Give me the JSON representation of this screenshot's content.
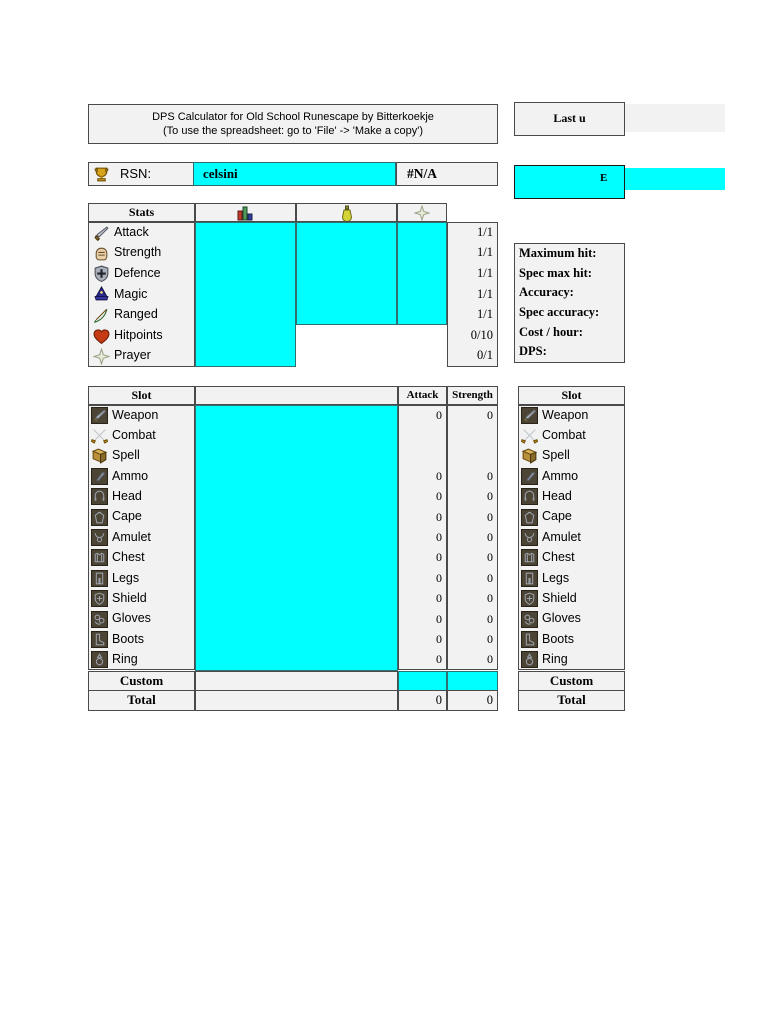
{
  "title": {
    "line1": "DPS Calculator for Old School Runescape by Bitterkoekje",
    "line2": "(To use the spreadsheet: go to 'File' -> 'Make a copy')"
  },
  "rsn": {
    "icon": "trophy-icon",
    "label": "RSN:",
    "value": "celsini",
    "status": "#N/A"
  },
  "stats": {
    "header": {
      "name": "Stats",
      "col_level_icon": "potions-icon",
      "col_boost_icon": "potion-flask-icon",
      "col_prayer_icon": "prayer-star-icon"
    },
    "rows": [
      {
        "icon": "attack-icon",
        "label": "Attack",
        "ratio": "1/1"
      },
      {
        "icon": "strength-icon",
        "label": "Strength",
        "ratio": "1/1"
      },
      {
        "icon": "defence-icon",
        "label": "Defence",
        "ratio": "1/1"
      },
      {
        "icon": "magic-icon",
        "label": "Magic",
        "ratio": "1/1"
      },
      {
        "icon": "ranged-icon",
        "label": "Ranged",
        "ratio": "1/1"
      },
      {
        "icon": "hitpoints-icon",
        "label": "Hitpoints",
        "ratio": "0/10"
      },
      {
        "icon": "prayer-icon",
        "label": "Prayer",
        "ratio": "0/1"
      }
    ]
  },
  "side_panel": {
    "last_updated_label": "Last u",
    "share_label": "E",
    "results": [
      {
        "label": "Maximum hit:"
      },
      {
        "label": "Spec max hit:"
      },
      {
        "label": "Accuracy:"
      },
      {
        "label": "Spec accuracy:"
      },
      {
        "label": "Cost / hour:"
      },
      {
        "label": "DPS:"
      }
    ]
  },
  "equipment": {
    "headers": {
      "slot": "Slot",
      "item": "",
      "attack": "Attack",
      "strength": "Strength"
    },
    "rows": [
      {
        "icon": "weapon-icon",
        "label": "Weapon",
        "attack": "0",
        "strength": "0"
      },
      {
        "icon": "combat-icon",
        "label": "Combat",
        "attack": "",
        "strength": ""
      },
      {
        "icon": "spell-icon",
        "label": "Spell",
        "attack": "",
        "strength": ""
      },
      {
        "icon": "ammo-icon",
        "label": "Ammo",
        "attack": "0",
        "strength": "0"
      },
      {
        "icon": "head-icon",
        "label": "Head",
        "attack": "0",
        "strength": "0"
      },
      {
        "icon": "cape-icon",
        "label": "Cape",
        "attack": "0",
        "strength": "0"
      },
      {
        "icon": "amulet-icon",
        "label": "Amulet",
        "attack": "0",
        "strength": "0"
      },
      {
        "icon": "chest-icon",
        "label": "Chest",
        "attack": "0",
        "strength": "0"
      },
      {
        "icon": "legs-icon",
        "label": "Legs",
        "attack": "0",
        "strength": "0"
      },
      {
        "icon": "shield-icon",
        "label": "Shield",
        "attack": "0",
        "strength": "0"
      },
      {
        "icon": "gloves-icon",
        "label": "Gloves",
        "attack": "0",
        "strength": "0"
      },
      {
        "icon": "boots-icon",
        "label": "Boots",
        "attack": "0",
        "strength": "0"
      },
      {
        "icon": "ring-icon",
        "label": "Ring",
        "attack": "0",
        "strength": "0"
      }
    ],
    "custom": {
      "label": "Custom",
      "attack": "",
      "strength": ""
    },
    "total": {
      "label": "Total",
      "attack": "0",
      "strength": "0"
    }
  },
  "equipment_right": {
    "headers": {
      "slot": "Slot"
    },
    "custom": {
      "label": "Custom"
    },
    "total": {
      "label": "Total"
    }
  },
  "colors": {
    "input_cyan": "#00ffff",
    "cell_bg": "#f2f2f2",
    "border": "#4a4a4a",
    "input_border": "#2f6f6f"
  }
}
